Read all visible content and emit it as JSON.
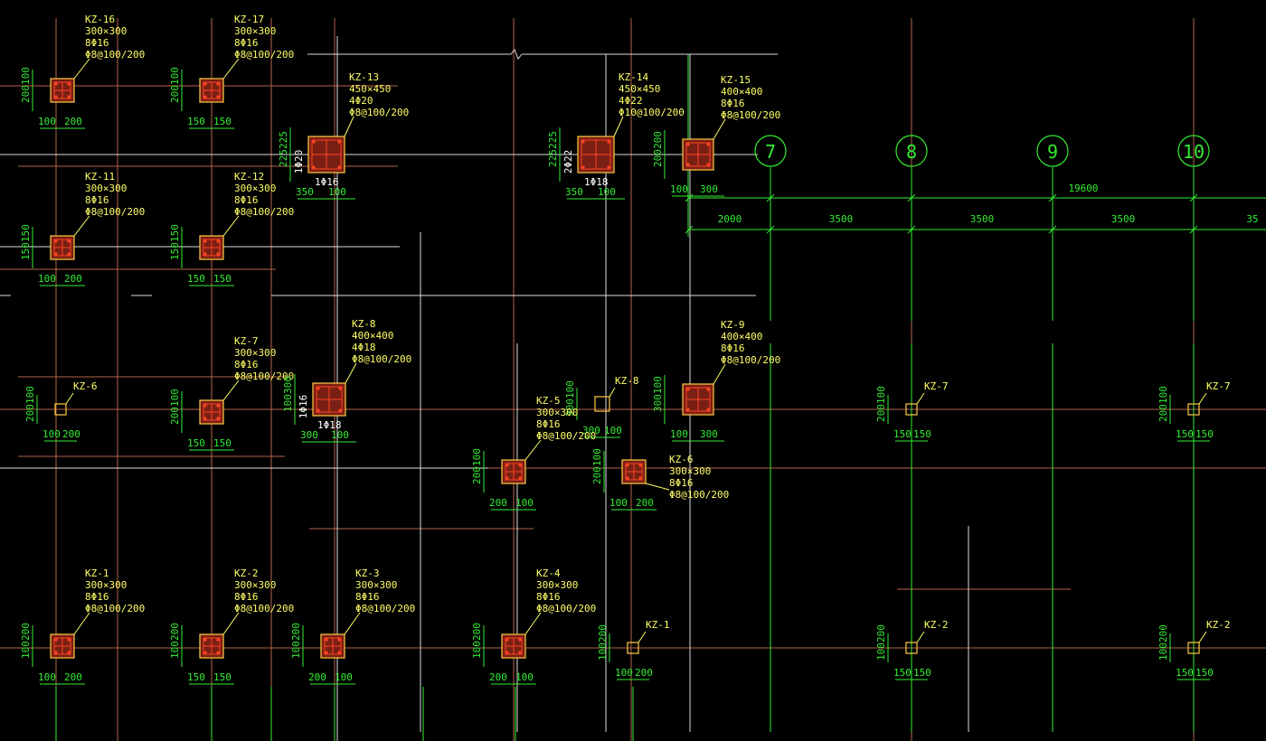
{
  "drawing": {
    "axis_labels": [
      "7",
      "8",
      "9",
      "10"
    ],
    "overall_dimension": "19600",
    "bay_dimensions": [
      "2000",
      "3500",
      "3500",
      "3500",
      "35"
    ]
  },
  "columns": [
    {
      "id": "kz16",
      "lines": [
        "KZ-16",
        "300×300",
        "8Φ16",
        "Φ8@100/200"
      ],
      "dims_h": [
        "100",
        "200"
      ],
      "dims_v": [
        "200",
        "100"
      ]
    },
    {
      "id": "kz17",
      "lines": [
        "KZ-17",
        "300×300",
        "8Φ16",
        "Φ8@100/200"
      ],
      "dims_h": [
        "150",
        "150"
      ],
      "dims_v": [
        "200",
        "100"
      ]
    },
    {
      "id": "kz13",
      "lines": [
        "KZ-13",
        "450×450",
        "4Φ20",
        "Φ8@100/200"
      ],
      "side": "1Φ20",
      "bottom": "1Φ16",
      "dims_h": [
        "350",
        "100"
      ],
      "dims_v": [
        "225",
        "225"
      ]
    },
    {
      "id": "kz14",
      "lines": [
        "KZ-14",
        "450×450",
        "4Φ22",
        "Φ10@100/200"
      ],
      "side": "2Φ22",
      "bottom": "1Φ18",
      "dims_h": [
        "350",
        "100"
      ],
      "dims_v": [
        "225",
        "225"
      ]
    },
    {
      "id": "kz15",
      "lines": [
        "KZ-15",
        "400×400",
        "8Φ16",
        "Φ8@100/200"
      ],
      "dims_h": [
        "100",
        "300"
      ],
      "dims_v": [
        "200",
        "200"
      ]
    },
    {
      "id": "kz11",
      "lines": [
        "KZ-11",
        "300×300",
        "8Φ16",
        "Φ8@100/200"
      ],
      "dims_h": [
        "100",
        "200"
      ],
      "dims_v": [
        "150",
        "150"
      ]
    },
    {
      "id": "kz12",
      "lines": [
        "KZ-12",
        "300×300",
        "8Φ16",
        "Φ8@100/200"
      ],
      "dims_h": [
        "150",
        "150"
      ],
      "dims_v": [
        "150",
        "150"
      ]
    },
    {
      "id": "kz6a",
      "lines": [
        "KZ-6"
      ],
      "dims_h": [
        "100",
        "200"
      ],
      "dims_v": [
        "200",
        "100"
      ]
    },
    {
      "id": "kz7a",
      "lines": [
        "KZ-7",
        "300×300",
        "8Φ16",
        "Φ8@100/200"
      ],
      "dims_h": [
        "150",
        "150"
      ],
      "dims_v": [
        "200",
        "100"
      ]
    },
    {
      "id": "kz8a",
      "lines": [
        "KZ-8",
        "400×400",
        "4Φ18",
        "Φ8@100/200"
      ],
      "side": "1Φ16",
      "bottom": "1Φ18",
      "dims_h": [
        "300",
        "100"
      ],
      "dims_v": [
        "100",
        "300"
      ]
    },
    {
      "id": "kz9",
      "lines": [
        "KZ-9",
        "400×400",
        "8Φ16",
        "Φ8@100/200"
      ],
      "dims_h": [
        "100",
        "300"
      ],
      "dims_v": [
        "300",
        "100"
      ]
    },
    {
      "id": "kz8b",
      "lines": [
        "KZ-8"
      ],
      "dims_h": [
        "300",
        "100"
      ],
      "dims_v": [
        "300",
        "100"
      ]
    },
    {
      "id": "kz5",
      "lines": [
        "KZ-5",
        "300×300",
        "8Φ16",
        "Φ8@100/200"
      ],
      "dims_h": [
        "200",
        "100"
      ],
      "dims_v": [
        "200",
        "100"
      ]
    },
    {
      "id": "kz6b",
      "lines": [
        "KZ-6",
        "300×300",
        "8Φ16",
        "Φ8@100/200"
      ],
      "dims_h": [
        "100",
        "200"
      ],
      "dims_v": [
        "200",
        "100"
      ]
    },
    {
      "id": "kz7b",
      "lines": [
        "KZ-7"
      ],
      "dims_h": [
        "150",
        "150"
      ],
      "dims_v": [
        "200",
        "100"
      ]
    },
    {
      "id": "kz7c",
      "lines": [
        "KZ-7"
      ],
      "dims_h": [
        "150",
        "150"
      ],
      "dims_v": [
        "200",
        "100"
      ]
    },
    {
      "id": "kz1a",
      "lines": [
        "KZ-1",
        "300×300",
        "8Φ16",
        "Φ8@100/200"
      ],
      "dims_h": [
        "100",
        "200"
      ],
      "dims_v": [
        "100",
        "200"
      ]
    },
    {
      "id": "kz2a",
      "lines": [
        "KZ-2",
        "300×300",
        "8Φ16",
        "Φ8@100/200"
      ],
      "dims_h": [
        "150",
        "150"
      ],
      "dims_v": [
        "100",
        "200"
      ]
    },
    {
      "id": "kz3",
      "lines": [
        "KZ-3",
        "300×300",
        "8Φ16",
        "Φ8@100/200"
      ],
      "dims_h": [
        "200",
        "100"
      ],
      "dims_v": [
        "100",
        "200"
      ]
    },
    {
      "id": "kz4",
      "lines": [
        "KZ-4",
        "300×300",
        "8Φ16",
        "Φ8@100/200"
      ],
      "dims_h": [
        "200",
        "100"
      ],
      "dims_v": [
        "100",
        "200"
      ]
    },
    {
      "id": "kz1b",
      "lines": [
        "KZ-1"
      ],
      "dims_h": [
        "100",
        "200"
      ],
      "dims_v": [
        "100",
        "200"
      ]
    },
    {
      "id": "kz2b",
      "lines": [
        "KZ-2"
      ],
      "dims_h": [
        "150",
        "150"
      ],
      "dims_v": [
        "100",
        "200"
      ]
    },
    {
      "id": "kz2c",
      "lines": [
        "KZ-2"
      ],
      "dims_h": [
        "150",
        "150"
      ],
      "dims_v": [
        "100",
        "200"
      ]
    }
  ],
  "colors": {
    "background": "#000000",
    "grid_brown": "#b5654a",
    "grid_white": "#dddddd",
    "dimension_green": "#33ee33",
    "label_yellow": "#ffff66",
    "column_outline": "#ffcc44",
    "column_fill": "#7a1f14",
    "rebar_red": "#ff4422"
  }
}
